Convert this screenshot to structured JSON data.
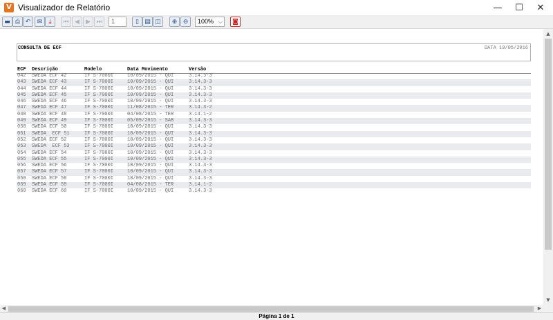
{
  "window": {
    "title": "Visualizador de Relatório",
    "icon_label": "V",
    "minimize_glyph": "—",
    "maximize_glyph": "☐",
    "close_glyph": "✕"
  },
  "toolbar": {
    "page_number": "1",
    "zoom": "100%",
    "zoom_arrow": "⌵",
    "icons": [
      {
        "name": "save-icon",
        "glyph": "▬"
      },
      {
        "name": "print-setup-icon",
        "glyph": "⎙"
      },
      {
        "name": "undo-icon",
        "glyph": "↶"
      },
      {
        "name": "email-icon",
        "glyph": "✉"
      },
      {
        "name": "pdf-icon",
        "glyph": "⤓"
      },
      {
        "name": "first-page-icon",
        "glyph": "⏮"
      },
      {
        "name": "previous-page-icon",
        "glyph": "◀"
      },
      {
        "name": "next-page-icon",
        "glyph": "▶"
      },
      {
        "name": "last-page-icon",
        "glyph": "⏭"
      },
      {
        "name": "page-width-icon",
        "glyph": "▯"
      },
      {
        "name": "whole-page-icon",
        "glyph": "▤"
      },
      {
        "name": "multiple-pages-icon",
        "glyph": "◫"
      },
      {
        "name": "zoom-in-icon",
        "glyph": "⊕"
      },
      {
        "name": "zoom-out-icon",
        "glyph": "⊖"
      },
      {
        "name": "close-report-icon",
        "glyph": "◙"
      }
    ]
  },
  "report": {
    "title": "CONSULTA DE ECF",
    "date": "DATA 19/05/2016",
    "columns": [
      "ECF",
      "Descrição",
      "Modelo",
      "Data Movimento",
      "Versão"
    ],
    "rows": [
      [
        "042",
        "SWEDA ECF 42",
        "IF S-7000I",
        "10/09/2015 - QUI",
        "3.14.3-3"
      ],
      [
        "043",
        "SWEDA ECF 43",
        "IF S-7000I",
        "10/09/2015 - QUI",
        "3.14.3-3"
      ],
      [
        "044",
        "SWEDA ECF 44",
        "IF S-7000I",
        "10/09/2015 - QUI",
        "3.14.3-3"
      ],
      [
        "045",
        "SWEDA ECF 45",
        "IF S-7000I",
        "10/09/2015 - QUI",
        "3.14.3-3"
      ],
      [
        "046",
        "SWEDA ECF 46",
        "IF S-7000I",
        "10/09/2015 - QUI",
        "3.14.3-3"
      ],
      [
        "047",
        "SWEDA ECF 47",
        "IF S-7000I",
        "11/08/2015 - TER",
        "3.14.3-2"
      ],
      [
        "048",
        "SWEDA ECF 48",
        "IF S-7000I",
        "04/08/2015 - TER",
        "3.14.1-2"
      ],
      [
        "049",
        "SWEDA ECF 49",
        "IF S-7000I",
        "05/09/2015 - SAB",
        "3.14.3-3"
      ],
      [
        "050",
        "SWEDA ECF 50",
        "IF S-7000I",
        "10/09/2015 - QUI",
        "3.14.3-3"
      ],
      [
        "051",
        "SWEDA  ECF 51",
        "IF S-7000I",
        "10/09/2015 - QUI",
        "3.14.3-3"
      ],
      [
        "052",
        "SWEDA ECF 52",
        "IF S-7000I",
        "10/09/2015 - QUI",
        "3.14.3-3"
      ],
      [
        "053",
        "SWEDA  ECF 53",
        "IF S-7000I",
        "10/09/2015 - QUI",
        "3.14.3-3"
      ],
      [
        "054",
        "SWEDA ECF 54",
        "IF S-7000I",
        "10/09/2015 - QUI",
        "3.14.3-3"
      ],
      [
        "055",
        "SWEDA ECF 55",
        "IF S-7000I",
        "10/09/2015 - QUI",
        "3.14.3-3"
      ],
      [
        "056",
        "SWEDA ECF 56",
        "IF S-7000I",
        "10/09/2015 - QUI",
        "3.14.3-3"
      ],
      [
        "057",
        "SWEDA ECF 57",
        "IF S-7000I",
        "10/09/2015 - QUI",
        "3.14.3-3"
      ],
      [
        "058",
        "SWEDA ECF 58",
        "IF S-7000I",
        "10/09/2015 - QUI",
        "3.14.3-3"
      ],
      [
        "059",
        "SWEDA ECF 59",
        "IF S-7000I",
        "04/08/2015 - TER",
        "3.14.1-2"
      ],
      [
        "060",
        "SWEDA ECF 60",
        "IF S-7000I",
        "10/09/2015 - QUI",
        "3.14.3-3"
      ]
    ]
  },
  "scrollbars": {
    "up_arrow": "▲",
    "down_arrow": "▼",
    "left_arrow": "◀",
    "right_arrow": "▶"
  },
  "status": {
    "page_info": "Página 1 de 1"
  }
}
